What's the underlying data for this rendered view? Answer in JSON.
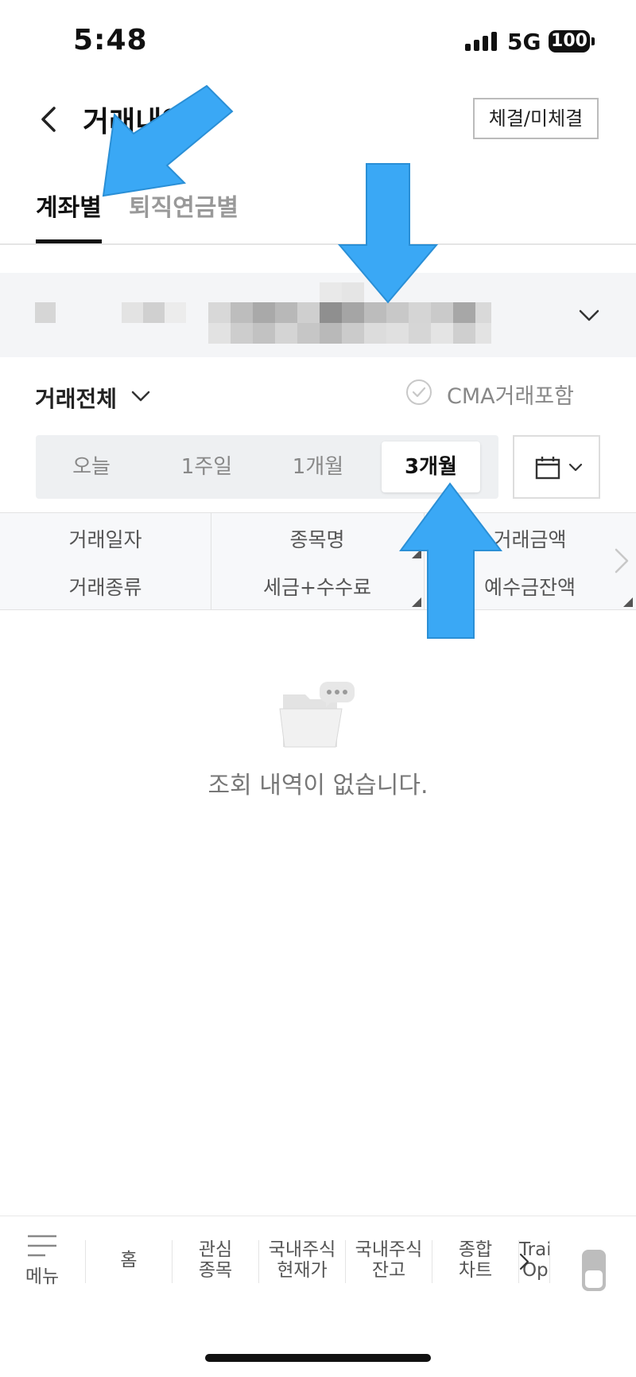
{
  "status_bar": {
    "time": "5:48",
    "network": "5G",
    "battery": "100"
  },
  "header": {
    "title": "거래내역",
    "exec_button": "체결/미체결"
  },
  "tabs": [
    {
      "label": "계좌별",
      "active": true
    },
    {
      "label": "퇴직연금별",
      "active": false
    }
  ],
  "account": {
    "masked": true
  },
  "filter": {
    "label": "거래전체",
    "cma_label": "CMA거래포함",
    "cma_checked": false
  },
  "periods": [
    {
      "label": "오늘",
      "active": false
    },
    {
      "label": "1주일",
      "active": false
    },
    {
      "label": "1개월",
      "active": false
    },
    {
      "label": "3개월",
      "active": true
    }
  ],
  "table_header": {
    "row1": [
      "거래일자",
      "종목명",
      "거래금액"
    ],
    "row2": [
      "거래종류",
      "세금+수수료",
      "예수금잔액"
    ]
  },
  "empty_state": {
    "message": "조회 내역이 없습니다."
  },
  "bottom_nav": {
    "menu": "메뉴",
    "items": [
      "홈",
      "관심\n종목",
      "국내주식\n현재가",
      "국내주식\n잔고",
      "종합\n차트",
      "Trai\nOp"
    ]
  },
  "colors": {
    "accent_arrow": "#3aa8f5",
    "active_text": "#111111",
    "muted_text": "#888888"
  }
}
